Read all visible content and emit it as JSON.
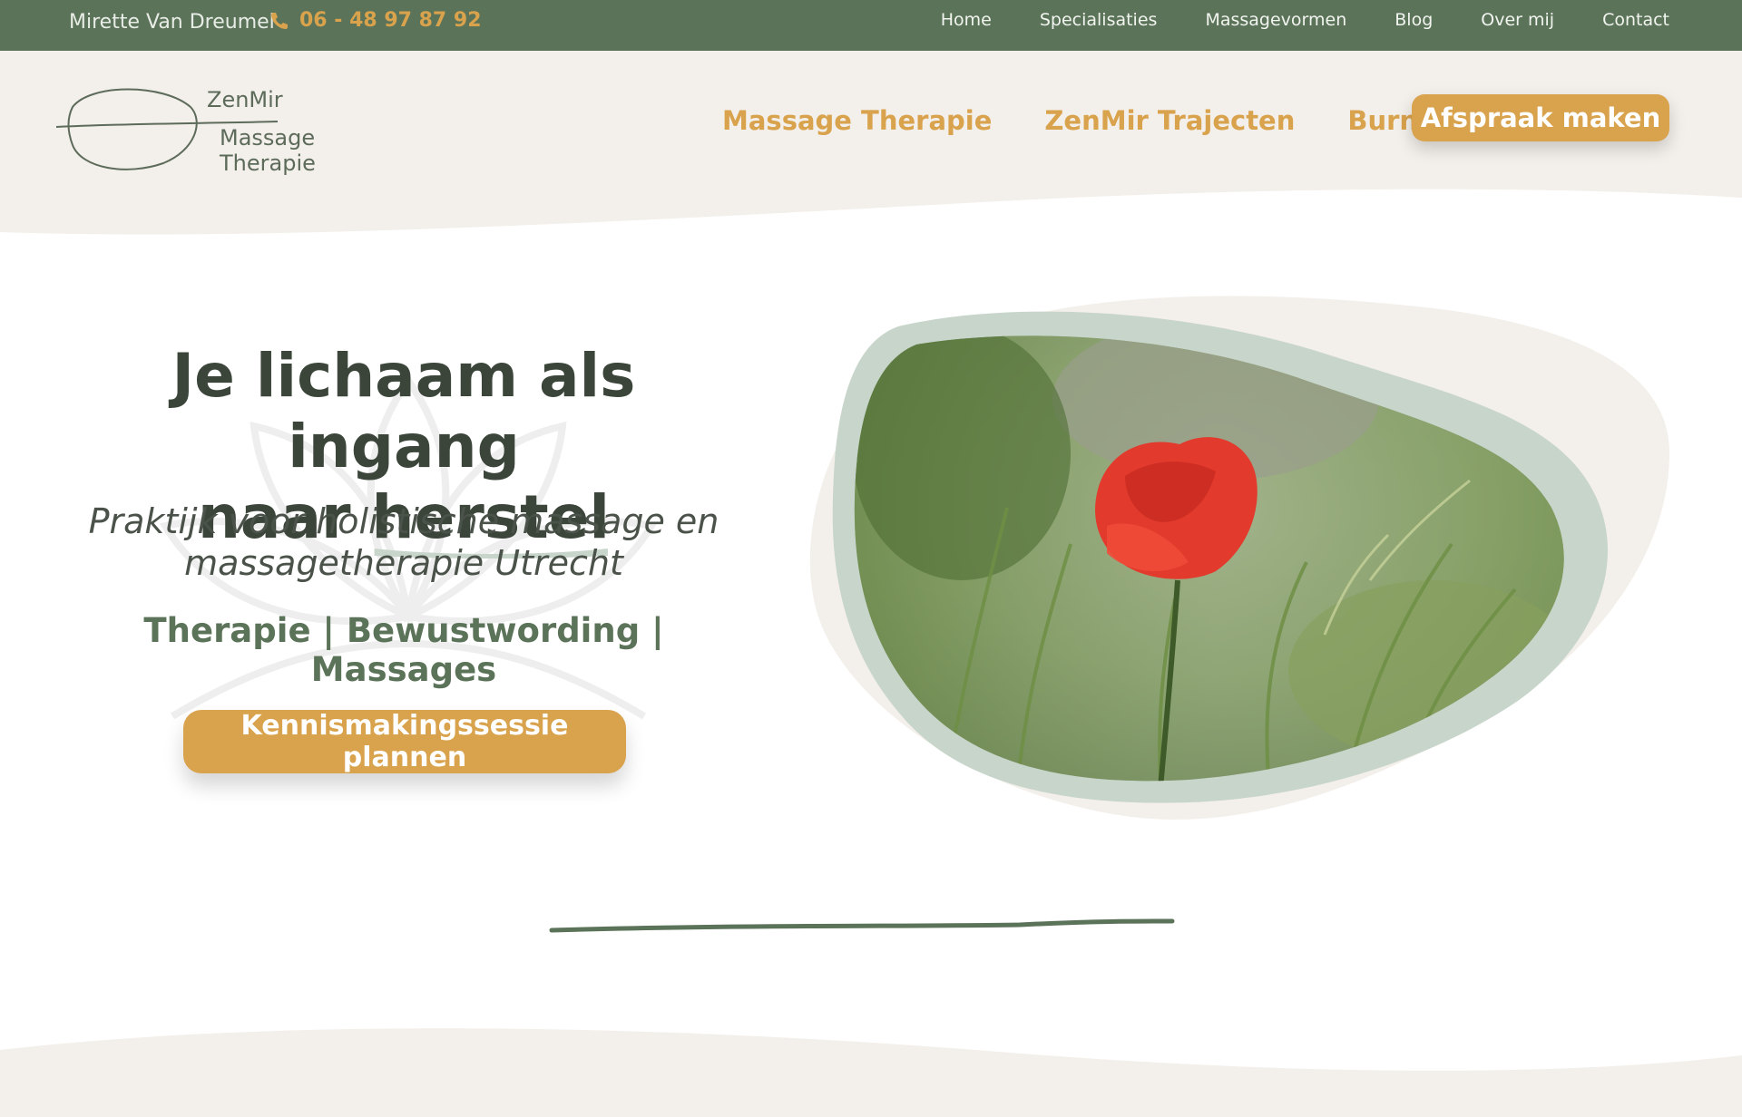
{
  "topbar": {
    "owner": "Mirette Van Dreumel",
    "phone": "06 - 48 97 87 92",
    "nav": [
      "Home",
      "Specialisaties",
      "Massagevormen",
      "Blog",
      "Over mij",
      "Contact"
    ]
  },
  "header": {
    "logo_name": "ZenMir",
    "logo_sub": "Massage Therapie",
    "nav": [
      "Massage Therapie",
      "ZenMir Trajecten",
      "Burn out?"
    ],
    "cta": "Afspraak maken"
  },
  "hero": {
    "title_line1": "Je lichaam als ingang",
    "title_line2_prefix": "naar ",
    "title_line2_highlight": "herstel",
    "tagline": "Praktijk voor holistische massage en massagetherapie Utrecht",
    "pillars": "Therapie | Bewustwording | Massages",
    "cta": "Kennismakingssessie plannen"
  },
  "colors": {
    "topbar_green": "#5b7358",
    "accent_orange": "#d9a24c",
    "cream": "#f3efea",
    "sage": "#c8d5cb",
    "dark_text": "#3b453a"
  },
  "icons": [
    "phone-icon",
    "logo-leaf-icon",
    "lotus-watermark-icon"
  ]
}
